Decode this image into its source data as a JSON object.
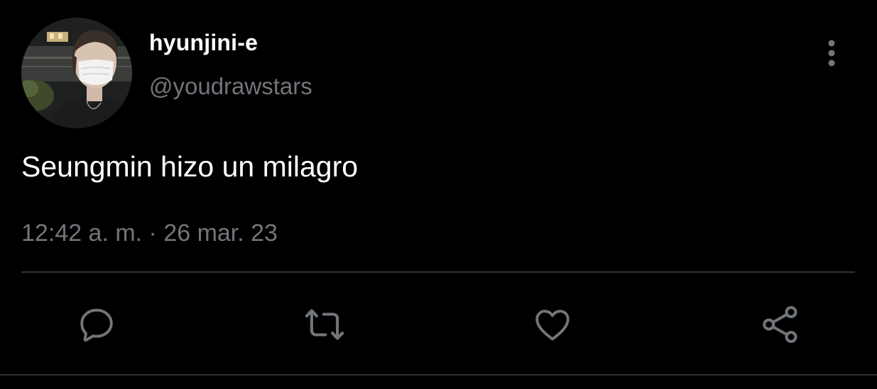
{
  "tweet": {
    "display_name": "hyunjini-e",
    "handle": "@youdrawstars",
    "text": "Seungmin hizo un milagro",
    "timestamp": "12:42 a. m. · 26 mar. 23"
  },
  "icons": {
    "more": "more-vertical-icon",
    "reply": "reply-icon",
    "retweet": "retweet-icon",
    "like": "heart-icon",
    "share": "share-icon"
  },
  "colors": {
    "background": "#000000",
    "primary_text": "#ffffff",
    "secondary_text": "#71767b",
    "divider": "#2f3336",
    "icon": "#71767b"
  }
}
